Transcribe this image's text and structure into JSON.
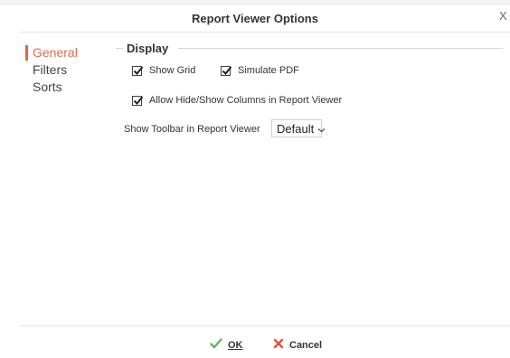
{
  "dialog": {
    "title": "Report Viewer Options",
    "close_glyph": "X"
  },
  "nav": {
    "items": [
      {
        "label": "General",
        "active": true
      },
      {
        "label": "Filters",
        "active": false
      },
      {
        "label": "Sorts",
        "active": false
      }
    ]
  },
  "display": {
    "legend": "Display",
    "show_grid": {
      "label": "Show Grid",
      "checked": true
    },
    "simulate_pdf": {
      "label": "Simulate PDF",
      "checked": true
    },
    "allow_hide_show": {
      "label": "Allow Hide/Show Columns in Report Viewer",
      "checked": true
    },
    "toolbar": {
      "label": "Show Toolbar in Report Viewer",
      "value": "Default"
    }
  },
  "footer": {
    "ok_label": "OK",
    "cancel_label": "Cancel"
  },
  "colors": {
    "accent": "#e8623f",
    "ok_icon": "#5cb85c",
    "cancel_icon": "#e0533a"
  },
  "icons": {
    "close": "close-icon",
    "checkbox": "checkmark-icon",
    "dropdown": "chevron-down-icon",
    "ok": "check-icon",
    "cancel": "x-icon"
  }
}
